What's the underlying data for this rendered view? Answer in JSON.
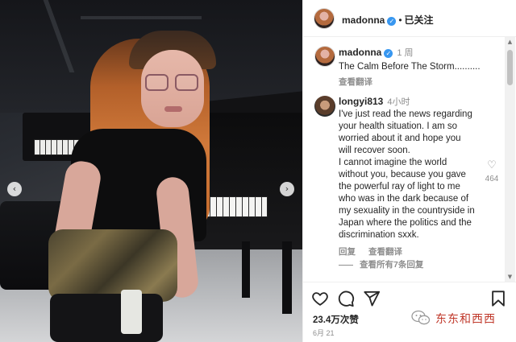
{
  "header": {
    "username": "madonna",
    "separator": "•",
    "follow_status": "已关注"
  },
  "caption": {
    "username": "madonna",
    "time_ago": "1 周",
    "text": "The Calm Before The Storm..........",
    "translate_label": "查看翻译"
  },
  "comment": {
    "username": "longyi813",
    "time_ago": "4小时",
    "paragraph1": "I've just read the news regarding your health situation. I am so worried about it and hope you will recover soon.",
    "paragraph2": "I cannot imagine the world without you, because you gave the powerful ray of light to me who was in the dark because of my sexuality in the countryside in Japan where the politics and the discrimination sxxk.",
    "like_count": "464",
    "reply_label": "回复",
    "translate_label": "查看翻译",
    "view_replies_label": "查看所有7条回复"
  },
  "actions": {
    "likes": "23.4万次赞",
    "date": "6月 21"
  },
  "icons": {
    "verified": "verified-badge-icon",
    "like": "heart-icon",
    "comment": "comment-bubble-icon",
    "share": "paper-plane-icon",
    "save": "bookmark-icon",
    "carousel_prev": "chevron-left-icon",
    "carousel_next": "chevron-right-icon",
    "comment_like": "small-heart-icon",
    "watermark_logo": "wechat-logo-icon"
  },
  "watermark": {
    "text": "东东和西西"
  },
  "colors": {
    "verified_blue": "#3897f0",
    "secondary_text": "#8e8e8e",
    "watermark_red": "#c0392b"
  }
}
